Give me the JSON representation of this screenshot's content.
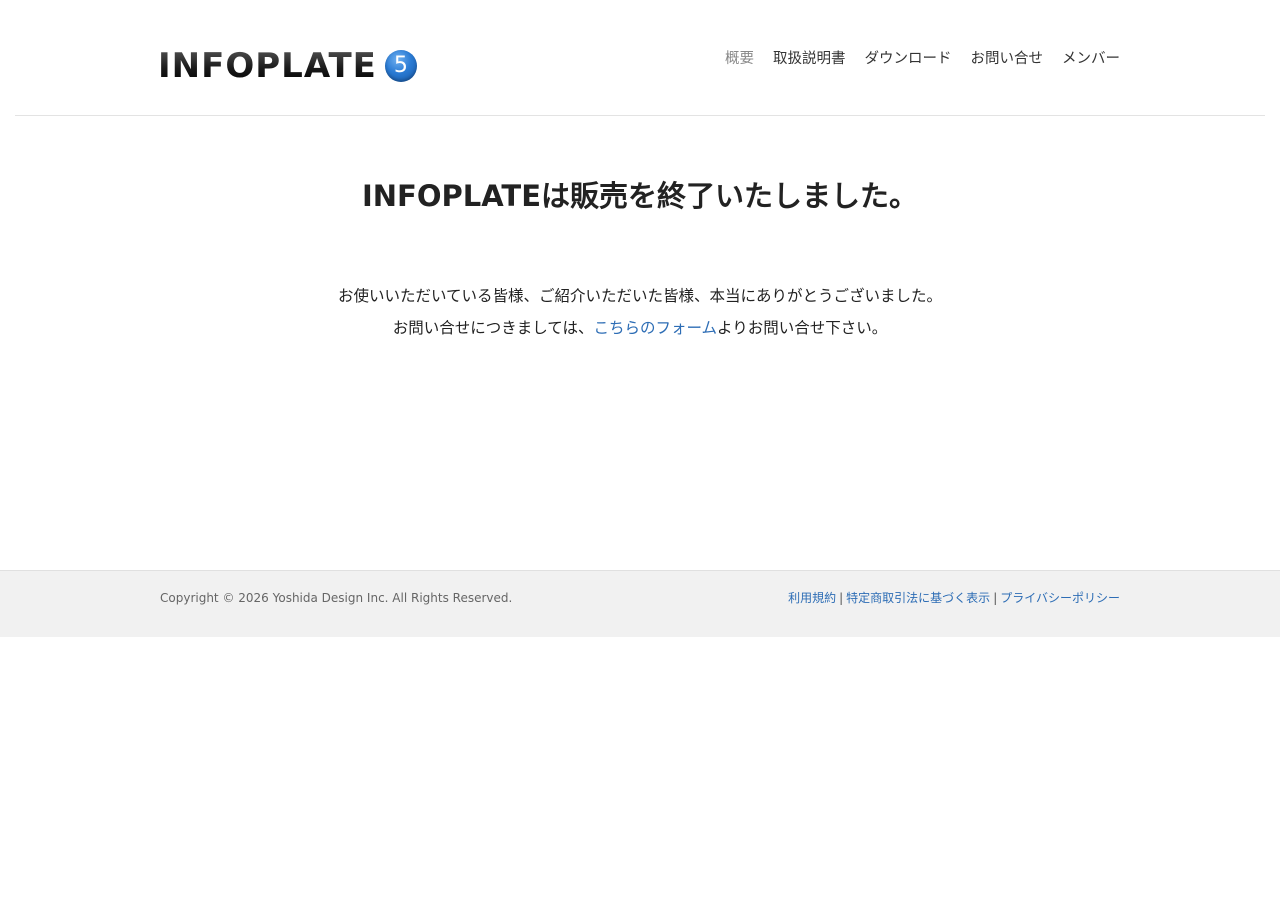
{
  "header": {
    "logo_text": "INFOPLATE",
    "logo_badge": "5",
    "nav": [
      {
        "label": "概要",
        "active": true
      },
      {
        "label": "取扱説明書",
        "active": false
      },
      {
        "label": "ダウンロード",
        "active": false
      },
      {
        "label": "お問い合せ",
        "active": false
      },
      {
        "label": "メンバー",
        "active": false
      }
    ]
  },
  "main": {
    "title": "INFOPLATEは販売を終了いたしました。",
    "line1": "お使いいただいている皆様、ご紹介いただいた皆様、本当にありがとうございました。",
    "line2_prefix": "お問い合せにつきましては、",
    "line2_link": "こちらのフォーム",
    "line2_suffix": "よりお問い合せ下さい。"
  },
  "footer": {
    "copyright": "Copyright © 2026 Yoshida Design Inc. All Rights Reserved.",
    "links": [
      "利用規約",
      "特定商取引法に基づく表示",
      "プライバシーポリシー"
    ],
    "separator": "|"
  },
  "colors": {
    "link": "#2d6db5",
    "nav_active": "#888888",
    "footer_bg": "#f1f1f1",
    "badge": "#2a7bd4"
  }
}
